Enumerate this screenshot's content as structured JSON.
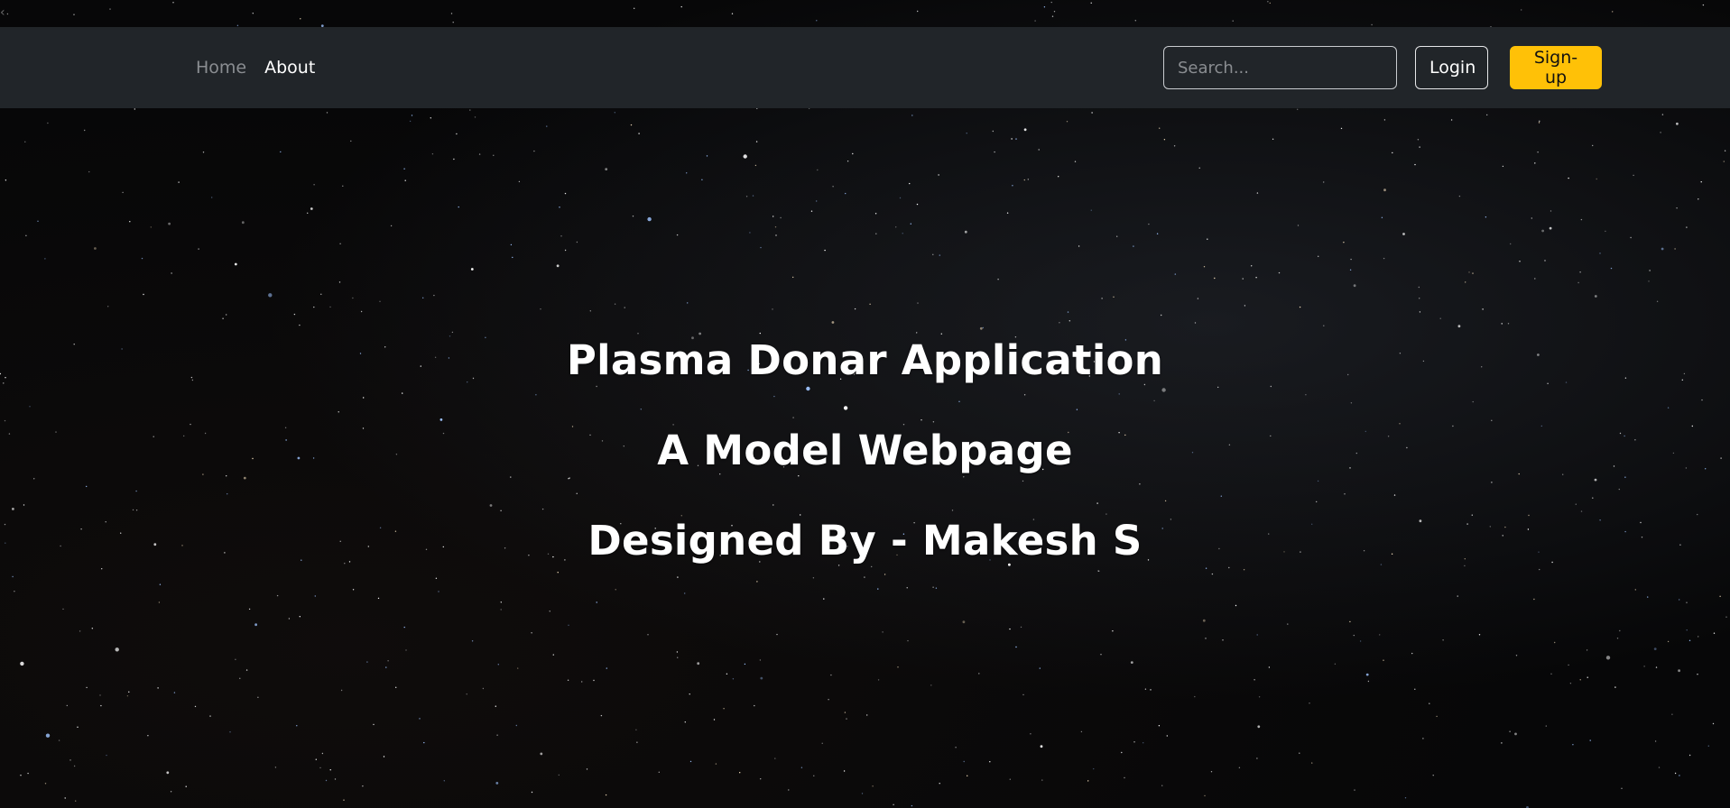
{
  "nav": {
    "links": [
      {
        "label": "Home",
        "state": "muted"
      },
      {
        "label": "About",
        "state": "active"
      }
    ]
  },
  "search": {
    "placeholder": "Search...",
    "value": ""
  },
  "buttons": {
    "login_label": "Login",
    "signup_label": "Sign-up"
  },
  "hero": {
    "title": "Plasma Donar Application",
    "subtitle": "A Model Webpage",
    "credit": "Designed By - Makesh S"
  },
  "colors": {
    "navbar_bg": "#212529",
    "accent": "#ffc107",
    "background": "#070708",
    "text": "#ffffff",
    "muted_text": "#8a8d91"
  },
  "icons": {
    "corner": "back-chevron-icon"
  }
}
